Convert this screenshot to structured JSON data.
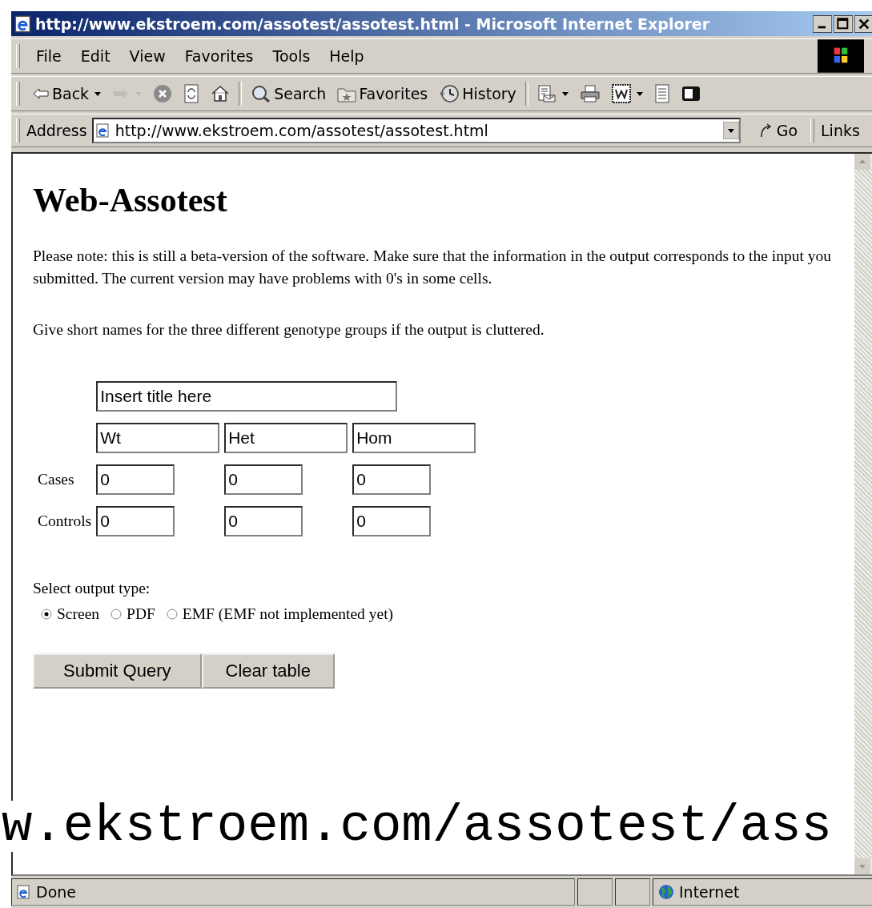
{
  "window": {
    "title": "http://www.ekstroem.com/assotest/assotest.html - Microsoft Internet Explorer"
  },
  "menu": [
    "File",
    "Edit",
    "View",
    "Favorites",
    "Tools",
    "Help"
  ],
  "toolbar": [
    {
      "kind": "back",
      "label": "Back",
      "dropdown": true,
      "disabled": false
    },
    {
      "kind": "forward",
      "dropdown": true,
      "disabled": true
    },
    {
      "kind": "stop",
      "dropdown": false,
      "disabled": false
    },
    {
      "kind": "refresh",
      "dropdown": false,
      "disabled": false
    },
    {
      "kind": "home",
      "dropdown": false,
      "disabled": false
    },
    {
      "kind": "search",
      "label": "Search",
      "dropdown": false,
      "disabled": false
    },
    {
      "kind": "favorites",
      "label": "Favorites",
      "dropdown": false,
      "disabled": false
    },
    {
      "kind": "history",
      "label": "History",
      "dropdown": false,
      "disabled": false
    },
    {
      "kind": "mail",
      "dropdown": true,
      "disabled": false
    },
    {
      "kind": "print",
      "dropdown": false,
      "disabled": false
    },
    {
      "kind": "edit",
      "dropdown": true,
      "disabled": false
    },
    {
      "kind": "discuss",
      "dropdown": false,
      "disabled": false
    },
    {
      "kind": "messenger",
      "dropdown": false,
      "disabled": false
    }
  ],
  "address": {
    "label": "Address",
    "url": "http://www.ekstroem.com/assotest/assotest.html",
    "go": "Go",
    "links": "Links"
  },
  "page": {
    "heading": "Web-Assotest",
    "paragraphs": [
      "Please note: this is still a beta-version of the software. Make sure that the information in the output corresponds to the input you submitted. The current version may have problems with 0's in some cells.",
      "Give short names for the three different genotype groups if the output is cluttered."
    ],
    "title_field": "Insert title here",
    "groups": [
      "Wt",
      "Het",
      "Hom"
    ],
    "rows": [
      {
        "label": "Cases",
        "values": [
          "0",
          "0",
          "0"
        ]
      },
      {
        "label": "Controls",
        "values": [
          "0",
          "0",
          "0"
        ]
      }
    ],
    "output_label": "Select output type:",
    "options": [
      {
        "label": "Screen",
        "selected": true
      },
      {
        "label": "PDF",
        "selected": false
      },
      {
        "label": "EMF (EMF not implemented yet)",
        "selected": false
      }
    ],
    "buttons": [
      "Submit Query",
      "Clear table"
    ]
  },
  "status": {
    "text": "Done",
    "zone": "Internet"
  },
  "caption": "w.ekstroem.com/assotest/ass"
}
